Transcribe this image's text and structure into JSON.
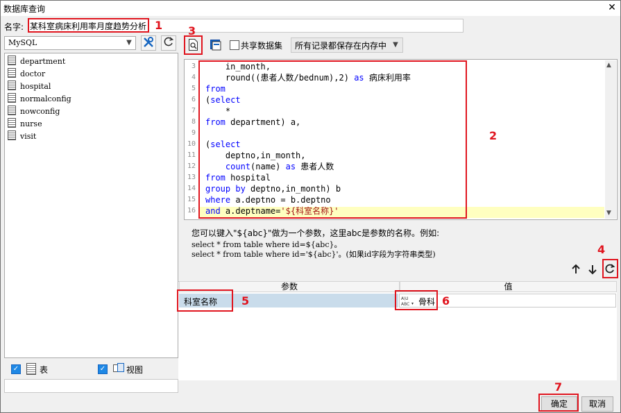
{
  "window": {
    "title": "数据库查询",
    "close_glyph": "✕"
  },
  "name_field": {
    "label": "名字:",
    "value": "某科室病床利用率月度趋势分析"
  },
  "annotations": [
    "1",
    "2",
    "3",
    "4",
    "5",
    "6",
    "7"
  ],
  "left_panel": {
    "connection": "MySQL",
    "tables": [
      "department",
      "doctor",
      "hospital",
      "normalconfig",
      "nowconfig",
      "nurse",
      "visit"
    ],
    "filter_table_label": "表",
    "filter_view_label": "视图",
    "filter_table_checked": true,
    "filter_view_checked": true
  },
  "toolbar": {
    "share_dataset_label": "共享数据集",
    "share_dataset_checked": false,
    "memory_mode": "所有记录都保存在内存中"
  },
  "editor": {
    "lines": [
      {
        "n": "3",
        "code": [
          [
            "",
            "    in_month,"
          ]
        ]
      },
      {
        "n": "4",
        "code": [
          [
            "",
            "    round(("
          ],
          [
            "",
            "患者人数/bednum),2) "
          ],
          [
            "kw",
            "as"
          ],
          [
            "",
            " 病床利用率"
          ]
        ]
      },
      {
        "n": "5",
        "code": [
          [
            "kw",
            "from"
          ]
        ]
      },
      {
        "n": "6",
        "code": [
          [
            "",
            "("
          ],
          [
            "kw",
            "select"
          ]
        ]
      },
      {
        "n": "7",
        "code": [
          [
            "",
            "    *"
          ]
        ]
      },
      {
        "n": "8",
        "code": [
          [
            "kw",
            "from"
          ],
          [
            "",
            " department) a,"
          ]
        ]
      },
      {
        "n": "9",
        "code": [
          [
            "",
            ""
          ]
        ]
      },
      {
        "n": "10",
        "code": [
          [
            "",
            "("
          ],
          [
            "kw",
            "select"
          ]
        ]
      },
      {
        "n": "11",
        "code": [
          [
            "",
            "    deptno,in_month,"
          ]
        ]
      },
      {
        "n": "12",
        "code": [
          [
            "fn",
            "    count"
          ],
          [
            "",
            "(name) "
          ],
          [
            "kw",
            "as"
          ],
          [
            "",
            " 患者人数"
          ]
        ]
      },
      {
        "n": "13",
        "code": [
          [
            "kw",
            "from"
          ],
          [
            "",
            " hospital"
          ]
        ]
      },
      {
        "n": "14",
        "code": [
          [
            "kw",
            "group by"
          ],
          [
            "",
            " deptno,in_month) b"
          ]
        ]
      },
      {
        "n": "15",
        "code": [
          [
            "kw",
            "where"
          ],
          [
            "",
            " a.deptno = b.deptno"
          ]
        ]
      },
      {
        "n": "16",
        "code": [
          [
            "kw",
            "and"
          ],
          [
            "",
            " a.deptname="
          ],
          [
            "str",
            "'${科室名称}'"
          ]
        ]
      }
    ]
  },
  "hint": {
    "line1": "您可以键入\"${abc}\"做为一个参数，这里abc是参数的名称。例如:",
    "line2": "select * from table where id=${abc}。",
    "line3": "select * from table where id='${abc}'。(如果id字段为字符串类型)"
  },
  "params": {
    "col_param": "参数",
    "col_value": "值",
    "rows": [
      {
        "name": "科室名称",
        "type_icon": "ABC",
        "value": "骨科"
      }
    ]
  },
  "buttons": {
    "ok": "确定",
    "cancel": "取消"
  },
  "colors": {
    "annotation": "#e0141e",
    "keyword": "#0000ff",
    "string": "#a31515",
    "highlight_line": "#ffffc0",
    "selected_row": "#c9dceb"
  }
}
